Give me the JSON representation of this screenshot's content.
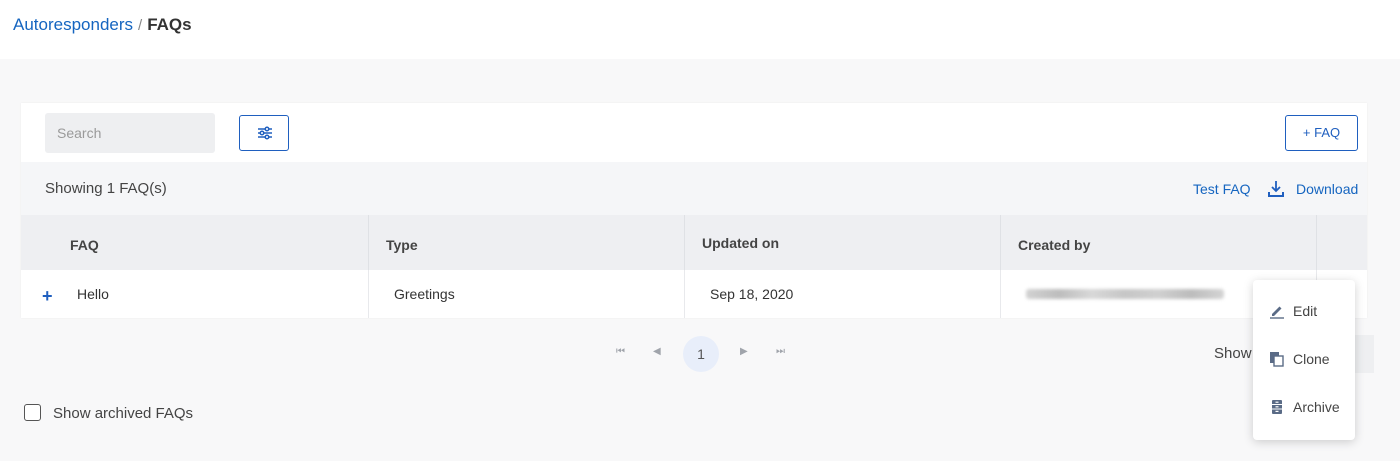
{
  "breadcrumb": {
    "parent": "Autoresponders",
    "separator": "/",
    "current": "FAQs"
  },
  "toolbar": {
    "search_placeholder": "Search",
    "add_label": "+ FAQ"
  },
  "summary": {
    "showing": "Showing 1 FAQ(s)",
    "test_faq": "Test FAQ",
    "download": "Download"
  },
  "table": {
    "headers": [
      "FAQ",
      "Type",
      "Updated on",
      "Created by"
    ],
    "rows": [
      {
        "expand": "+",
        "faq": "Hello",
        "type": "Greetings",
        "updated_on": "Sep 18, 2020"
      }
    ]
  },
  "pagination": {
    "current_page": "1",
    "first": "⏮",
    "prev": "◀",
    "next": "▶",
    "last": "⏭"
  },
  "page_size": {
    "label": "Show"
  },
  "archived": {
    "label": "Show archived FAQs",
    "checked": false
  },
  "context_menu": {
    "items": [
      "Edit",
      "Clone",
      "Archive"
    ]
  },
  "colors": {
    "accent": "#1f5fbf",
    "link": "#1565c0"
  }
}
